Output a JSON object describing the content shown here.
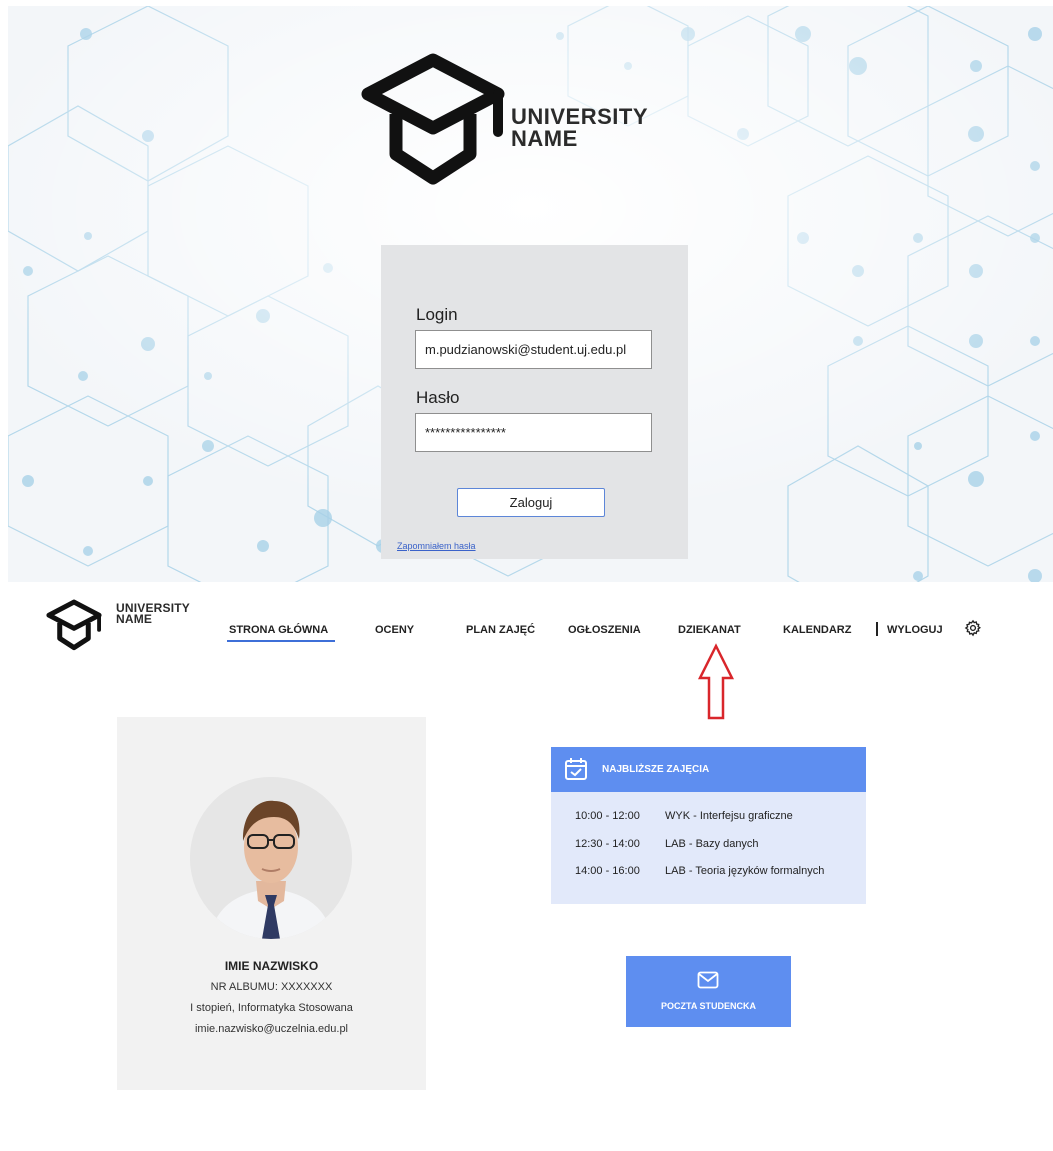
{
  "login": {
    "logo_line1": "UNIVERSITY",
    "logo_line2": "NAME",
    "login_label": "Login",
    "login_value": "m.pudzianowski@student.uj.edu.pl",
    "password_label": "Hasło",
    "password_value": "****************",
    "submit_label": "Zaloguj",
    "forgot_label": "Zapomniałem hasła"
  },
  "navbar": {
    "logo_line1": "UNIVERSITY",
    "logo_line2": "NAME",
    "items": [
      {
        "label": "STRONA GŁÓWNA",
        "active": true
      },
      {
        "label": "OCENY"
      },
      {
        "label": "PLAN ZAJĘĆ"
      },
      {
        "label": "OGŁOSZENIA"
      },
      {
        "label": "DZIEKANAT"
      },
      {
        "label": "KALENDARZ"
      }
    ],
    "logout_label": "WYLOGUJ"
  },
  "profile": {
    "name": "IMIE NAZWISKO",
    "album": "NR ALBUMU: XXXXXXX",
    "program": "I stopień, Informatyka Stosowana",
    "email": "imie.nazwisko@uczelnia.edu.pl"
  },
  "classes": {
    "title": "NAJBLIŻSZE ZAJĘCIA",
    "rows": [
      {
        "time": "10:00 - 12:00",
        "name": "WYK - Interfejsu graficzne"
      },
      {
        "time": "12:30 - 14:00",
        "name": "LAB - Bazy danych"
      },
      {
        "time": "14:00 - 16:00",
        "name": "LAB - Teoria języków formalnych"
      }
    ]
  },
  "mail": {
    "label": "POCZTA STUDENCKA"
  },
  "colors": {
    "accent": "#5e8ef0",
    "nav_underline": "#3e6fd8",
    "arrow": "#d9262b",
    "login_panel": "#e3e4e6"
  }
}
